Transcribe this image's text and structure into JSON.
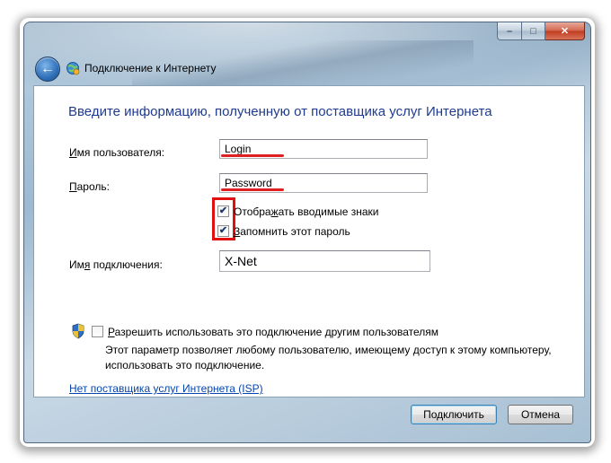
{
  "window": {
    "caption_minimize": "–",
    "caption_maximize": "□",
    "caption_close": "✕"
  },
  "header": {
    "back_glyph": "←",
    "title": "Подключение к Интернету",
    "icon": "network-globe-icon"
  },
  "form": {
    "instruction": "Введите информацию, полученную от поставщика услуг Интернета",
    "username_label_pre": "",
    "username_label_underlined": "И",
    "username_label_post": "мя пользователя:",
    "username_value": "Login",
    "password_label_pre": "",
    "password_label_underlined": "П",
    "password_label_post": "ароль:",
    "password_value": "Password",
    "show_chars_label_pre": "Отобра",
    "show_chars_label_underlined": "ж",
    "show_chars_label_post": "ать вводимые знаки",
    "show_chars_checked": true,
    "remember_label_pre": "",
    "remember_label_underlined": "З",
    "remember_label_post": "апомнить этот пароль",
    "remember_checked": true,
    "conn_name_label_pre": "Им",
    "conn_name_label_underlined": "я",
    "conn_name_label_post": " подключения:",
    "conn_name_value": "X-Net",
    "allow_others_label_pre": "",
    "allow_others_label_underlined": "Р",
    "allow_others_label_post": "азрешить использовать это подключение другим пользователям",
    "allow_others_checked": false,
    "allow_others_desc": "Этот параметр позволяет любому пользователю, имеющему доступ к этому компьютеру, использовать это подключение.",
    "no_isp_link": "Нет поставщика услуг Интернета (ISP)",
    "check_glyph": "✔"
  },
  "footer": {
    "connect_button": "Подключить",
    "cancel_button": "Отмена"
  },
  "colors": {
    "instruction_text": "#1e3b8f",
    "link": "#0645ad",
    "annotation_red": "#e02020"
  }
}
